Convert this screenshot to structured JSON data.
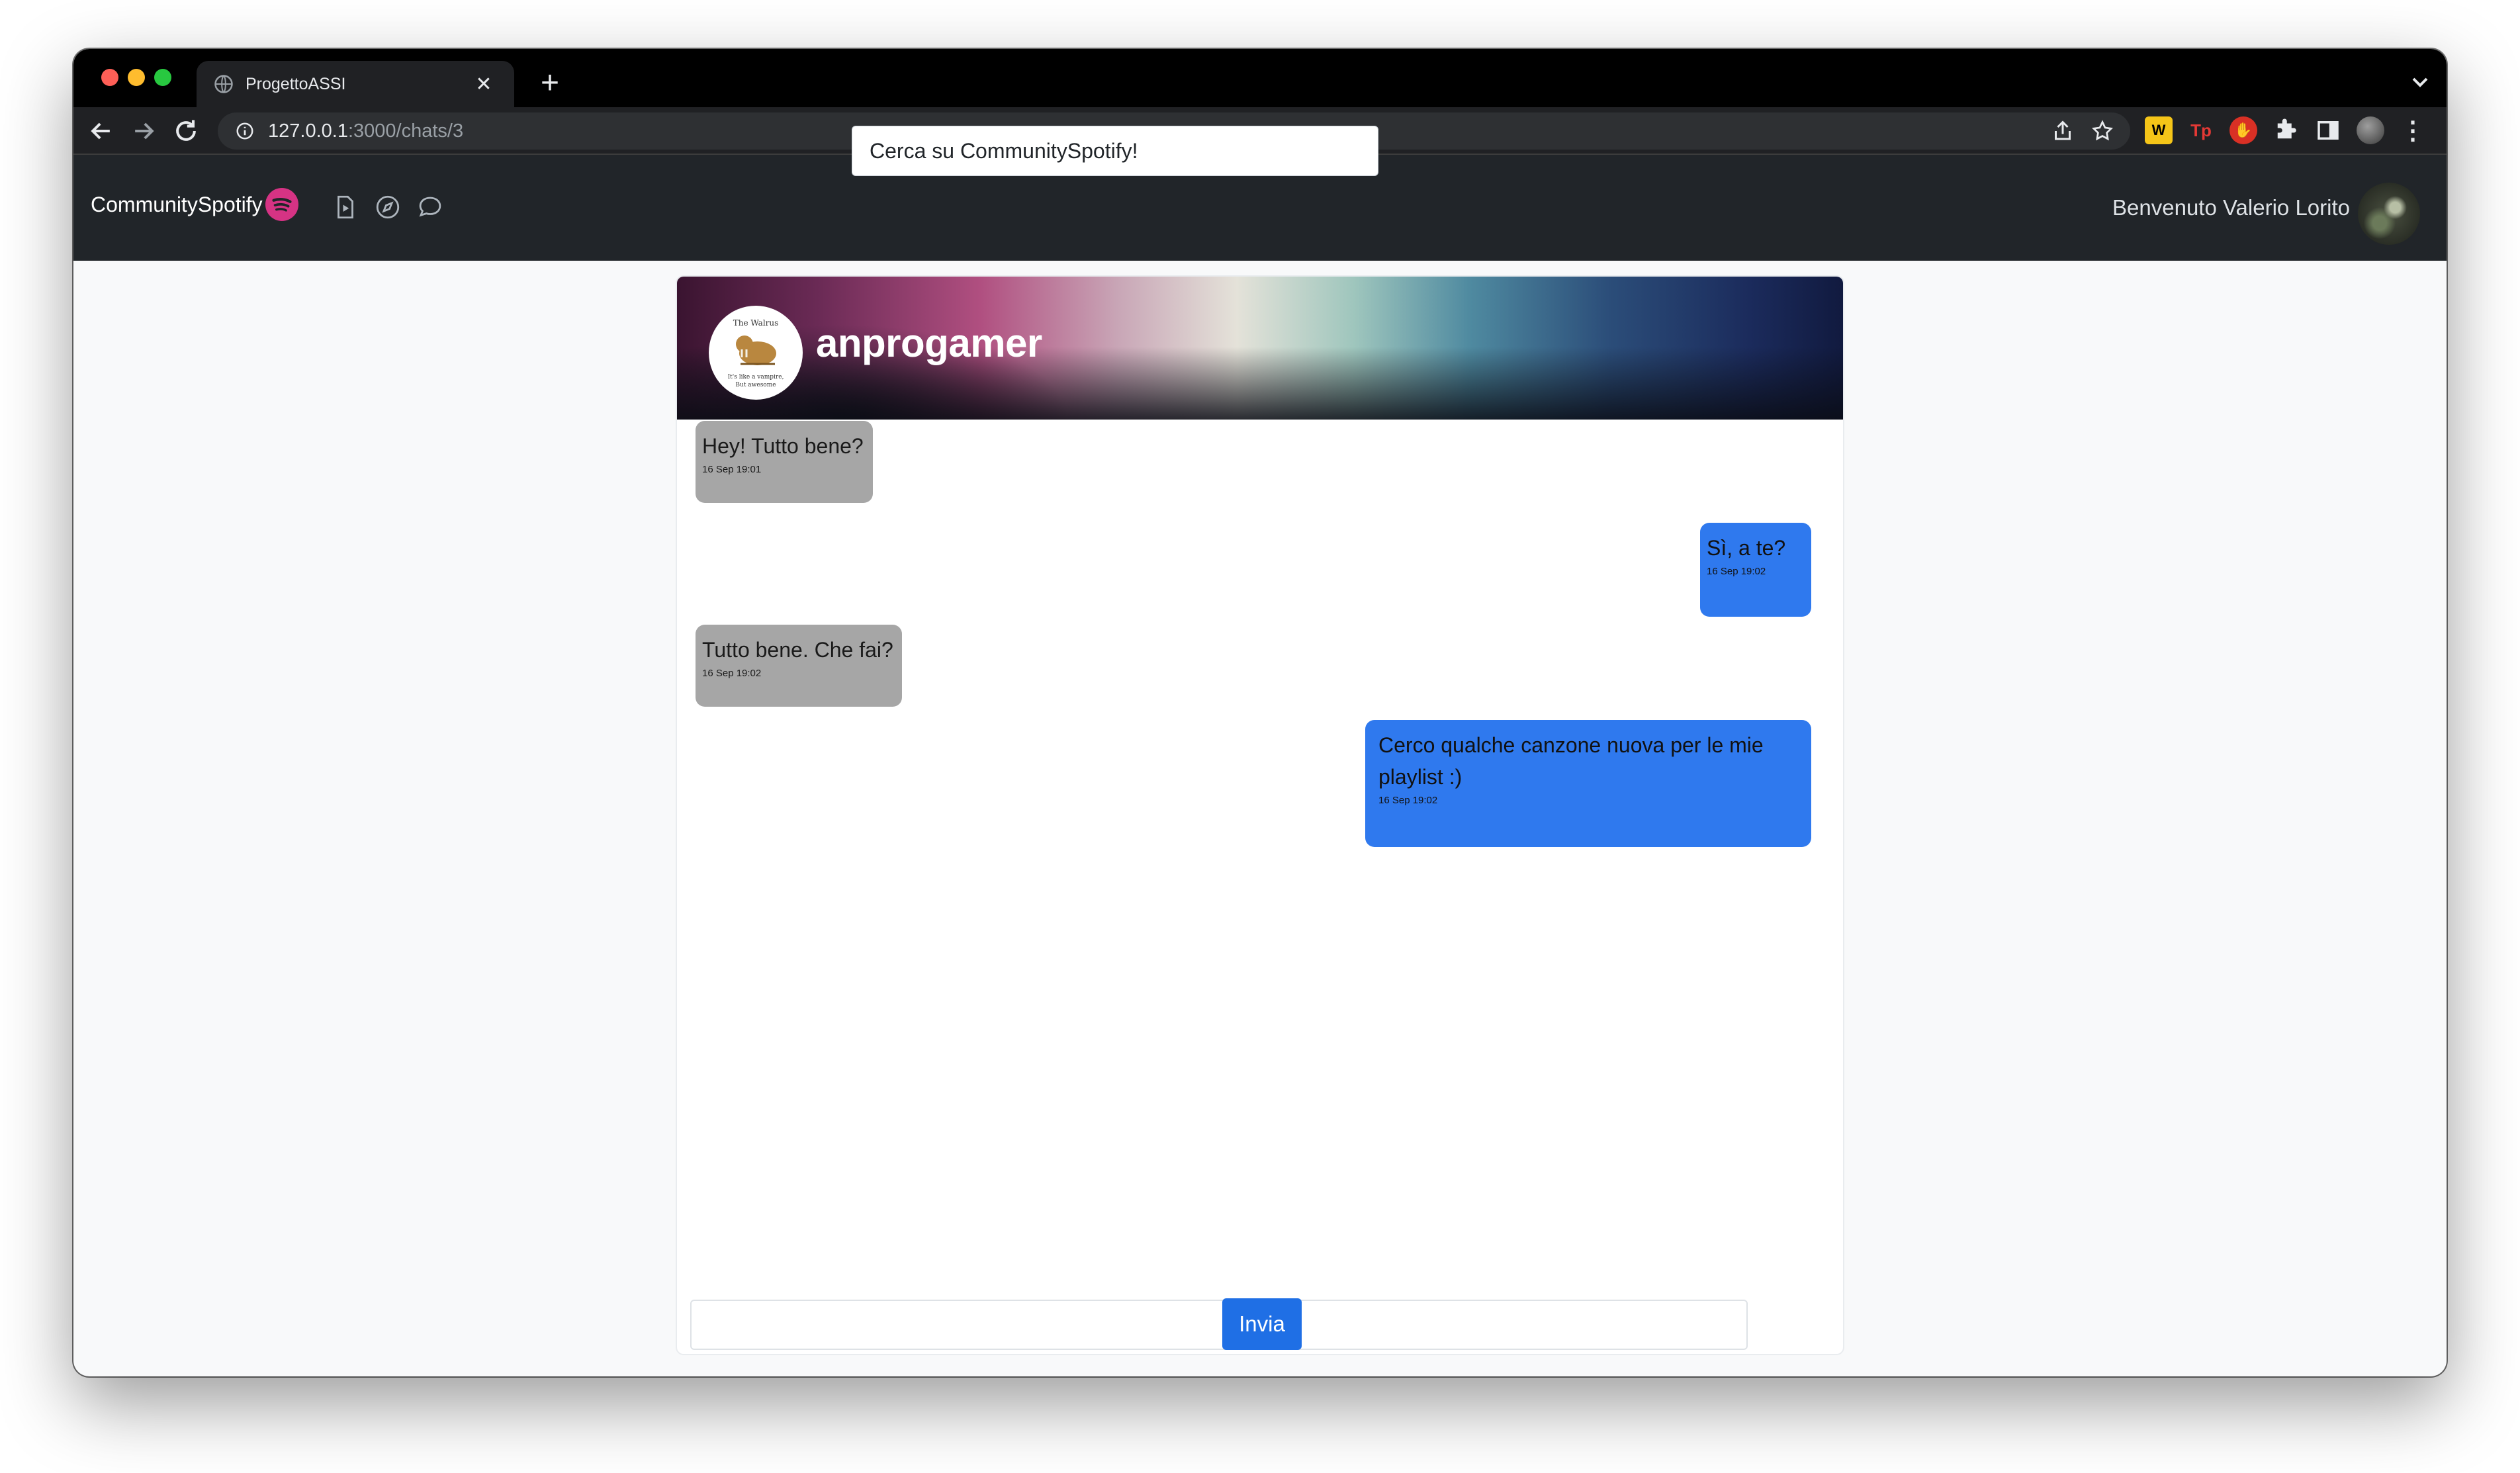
{
  "browser": {
    "tab_title": "ProgettoASSI",
    "url_host": "127.0.0.1",
    "url_path": ":3000/chats/3"
  },
  "icons": {
    "tab_favicon": "globe-icon",
    "tab_close": "close-icon",
    "new_tab": "plus-icon",
    "back": "arrow-left-icon",
    "forward": "arrow-right-icon",
    "reload": "reload-icon",
    "site_info": "info-icon",
    "share": "share-icon",
    "bookmark": "star-icon",
    "extensions": "puzzle-icon",
    "side_panel": "side-panel-icon",
    "menu": "kebab-menu-icon",
    "brand_logo": "spotify-icon",
    "nav_file": "file-play-icon",
    "nav_compass": "compass-icon",
    "nav_chat": "chat-bubble-icon"
  },
  "app": {
    "brand": "CommunitySpotify",
    "search_placeholder": "Cerca su CommunitySpotify!",
    "welcome": "Benvenuto Valerio Lorito"
  },
  "colors": {
    "navbar": "#212529",
    "brand_accent": "#d63384",
    "incoming_bubble": "#a6a6a6",
    "outgoing_bubble": "#2f79ee",
    "send_button": "#1f6fe5"
  },
  "chat": {
    "contact_name": "anprogamer",
    "avatar_text": [
      "The Walrus",
      "It's like a vampire,",
      "But awesome"
    ],
    "messages": [
      {
        "direction": "in",
        "text": "Hey! Tutto bene?",
        "time": "16 Sep 19:01"
      },
      {
        "direction": "out",
        "text": "Sì, a te?",
        "time": "16 Sep 19:02"
      },
      {
        "direction": "in",
        "text": "Tutto bene. Che fai?",
        "time": "16 Sep 19:02"
      },
      {
        "direction": "out",
        "text": "Cerco qualche canzone nuova per le mie playlist :)",
        "time": "16 Sep 19:02"
      }
    ],
    "composer_value": "",
    "send_label": "Invia"
  }
}
